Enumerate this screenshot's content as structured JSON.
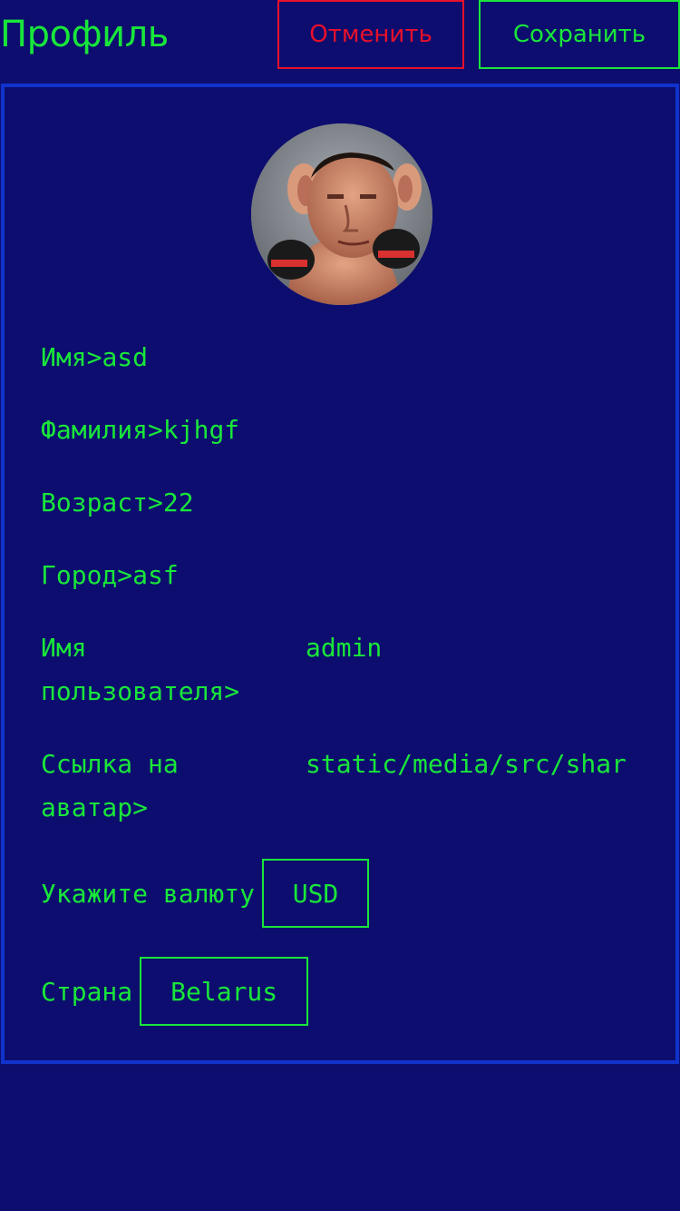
{
  "header": {
    "title": "Профиль",
    "cancel_label": "Отменить",
    "save_label": "Сохранить"
  },
  "colors": {
    "background": "#0d0d6f",
    "accent": "#19e63a",
    "danger": "#e8102a",
    "card_border": "#1133cc"
  },
  "profile": {
    "first_name": {
      "label": "Имя",
      "sep": ">",
      "value": "asd"
    },
    "last_name": {
      "label": "Фамилия",
      "sep": ">",
      "value": "kjhgf"
    },
    "age": {
      "label": "Возраст",
      "sep": ">",
      "value": "22"
    },
    "city": {
      "label": "Город",
      "sep": ">",
      "value": "asf"
    },
    "username": {
      "label": "Имя пользователя>",
      "value": "admin"
    },
    "avatar_link": {
      "label": "Ссылка на аватар>",
      "value": "static/media/src/shar"
    },
    "currency": {
      "label": "Укажите валюту",
      "value": "USD"
    },
    "country": {
      "label": "Страна",
      "value": "Belarus"
    }
  }
}
